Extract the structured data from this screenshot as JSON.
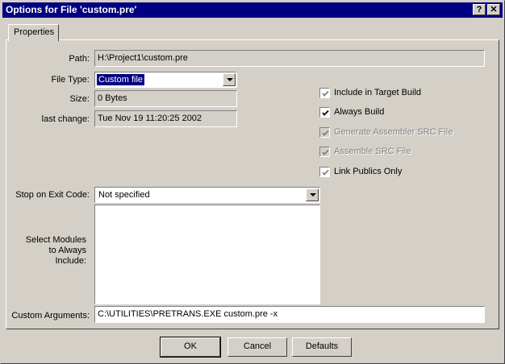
{
  "window": {
    "title": "Options for File 'custom.pre'",
    "help_button": "?",
    "close_button": "✕"
  },
  "tabs": [
    {
      "label": "Properties"
    }
  ],
  "form": {
    "path_label": "Path:",
    "path_value": "H:\\Project1\\custom.pre",
    "file_type_label": "File Type:",
    "file_type_value": "Custom file",
    "size_label": "Size:",
    "size_value": "0 Bytes",
    "last_change_label": "last change:",
    "last_change_value": "Tue Nov 19 11:20:25 2002",
    "stop_on_exit_label": "Stop on Exit Code:",
    "stop_on_exit_value": "Not specified",
    "modules_label": "Select Modules to Always Include:",
    "custom_args_label": "Custom Arguments:",
    "custom_args_value": "C:\\UTILITIES\\PRETRANS.EXE custom.pre -x"
  },
  "checkboxes": [
    {
      "label": "Include in Target Build",
      "checked": true,
      "disabled": false
    },
    {
      "label": "Always Build",
      "checked": true,
      "disabled": false
    },
    {
      "label": "Generate Assembler SRC File",
      "checked": true,
      "disabled": true
    },
    {
      "label": "Assemble SRC File",
      "checked": true,
      "disabled": true
    },
    {
      "label": "Link Publics Only",
      "checked": true,
      "disabled": false
    }
  ],
  "buttons": {
    "ok": "OK",
    "cancel": "Cancel",
    "defaults": "Defaults"
  }
}
